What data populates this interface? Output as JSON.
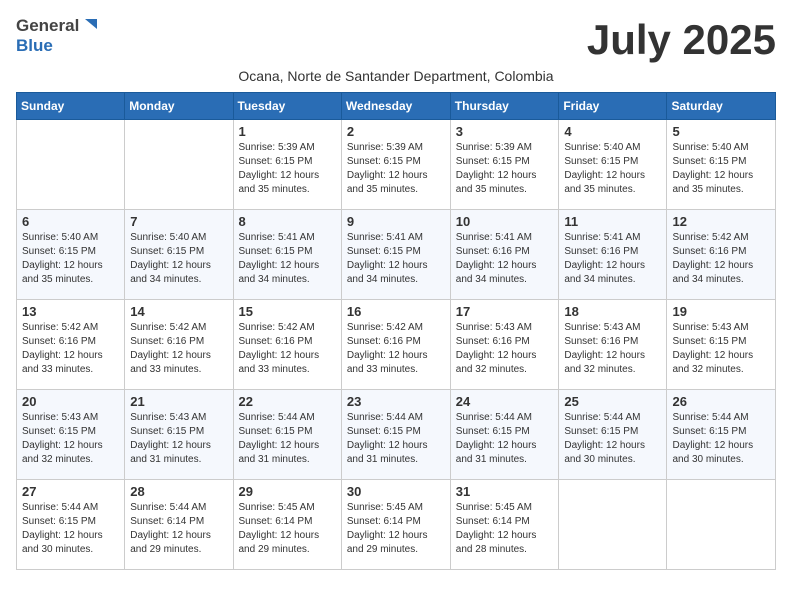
{
  "logo": {
    "general": "General",
    "blue": "Blue"
  },
  "title": "July 2025",
  "subtitle": "Ocana, Norte de Santander Department, Colombia",
  "weekdays": [
    "Sunday",
    "Monday",
    "Tuesday",
    "Wednesday",
    "Thursday",
    "Friday",
    "Saturday"
  ],
  "weeks": [
    [
      {
        "day": "",
        "info": ""
      },
      {
        "day": "",
        "info": ""
      },
      {
        "day": "1",
        "info": "Sunrise: 5:39 AM\nSunset: 6:15 PM\nDaylight: 12 hours and 35 minutes."
      },
      {
        "day": "2",
        "info": "Sunrise: 5:39 AM\nSunset: 6:15 PM\nDaylight: 12 hours and 35 minutes."
      },
      {
        "day": "3",
        "info": "Sunrise: 5:39 AM\nSunset: 6:15 PM\nDaylight: 12 hours and 35 minutes."
      },
      {
        "day": "4",
        "info": "Sunrise: 5:40 AM\nSunset: 6:15 PM\nDaylight: 12 hours and 35 minutes."
      },
      {
        "day": "5",
        "info": "Sunrise: 5:40 AM\nSunset: 6:15 PM\nDaylight: 12 hours and 35 minutes."
      }
    ],
    [
      {
        "day": "6",
        "info": "Sunrise: 5:40 AM\nSunset: 6:15 PM\nDaylight: 12 hours and 35 minutes."
      },
      {
        "day": "7",
        "info": "Sunrise: 5:40 AM\nSunset: 6:15 PM\nDaylight: 12 hours and 34 minutes."
      },
      {
        "day": "8",
        "info": "Sunrise: 5:41 AM\nSunset: 6:15 PM\nDaylight: 12 hours and 34 minutes."
      },
      {
        "day": "9",
        "info": "Sunrise: 5:41 AM\nSunset: 6:15 PM\nDaylight: 12 hours and 34 minutes."
      },
      {
        "day": "10",
        "info": "Sunrise: 5:41 AM\nSunset: 6:16 PM\nDaylight: 12 hours and 34 minutes."
      },
      {
        "day": "11",
        "info": "Sunrise: 5:41 AM\nSunset: 6:16 PM\nDaylight: 12 hours and 34 minutes."
      },
      {
        "day": "12",
        "info": "Sunrise: 5:42 AM\nSunset: 6:16 PM\nDaylight: 12 hours and 34 minutes."
      }
    ],
    [
      {
        "day": "13",
        "info": "Sunrise: 5:42 AM\nSunset: 6:16 PM\nDaylight: 12 hours and 33 minutes."
      },
      {
        "day": "14",
        "info": "Sunrise: 5:42 AM\nSunset: 6:16 PM\nDaylight: 12 hours and 33 minutes."
      },
      {
        "day": "15",
        "info": "Sunrise: 5:42 AM\nSunset: 6:16 PM\nDaylight: 12 hours and 33 minutes."
      },
      {
        "day": "16",
        "info": "Sunrise: 5:42 AM\nSunset: 6:16 PM\nDaylight: 12 hours and 33 minutes."
      },
      {
        "day": "17",
        "info": "Sunrise: 5:43 AM\nSunset: 6:16 PM\nDaylight: 12 hours and 32 minutes."
      },
      {
        "day": "18",
        "info": "Sunrise: 5:43 AM\nSunset: 6:16 PM\nDaylight: 12 hours and 32 minutes."
      },
      {
        "day": "19",
        "info": "Sunrise: 5:43 AM\nSunset: 6:15 PM\nDaylight: 12 hours and 32 minutes."
      }
    ],
    [
      {
        "day": "20",
        "info": "Sunrise: 5:43 AM\nSunset: 6:15 PM\nDaylight: 12 hours and 32 minutes."
      },
      {
        "day": "21",
        "info": "Sunrise: 5:43 AM\nSunset: 6:15 PM\nDaylight: 12 hours and 31 minutes."
      },
      {
        "day": "22",
        "info": "Sunrise: 5:44 AM\nSunset: 6:15 PM\nDaylight: 12 hours and 31 minutes."
      },
      {
        "day": "23",
        "info": "Sunrise: 5:44 AM\nSunset: 6:15 PM\nDaylight: 12 hours and 31 minutes."
      },
      {
        "day": "24",
        "info": "Sunrise: 5:44 AM\nSunset: 6:15 PM\nDaylight: 12 hours and 31 minutes."
      },
      {
        "day": "25",
        "info": "Sunrise: 5:44 AM\nSunset: 6:15 PM\nDaylight: 12 hours and 30 minutes."
      },
      {
        "day": "26",
        "info": "Sunrise: 5:44 AM\nSunset: 6:15 PM\nDaylight: 12 hours and 30 minutes."
      }
    ],
    [
      {
        "day": "27",
        "info": "Sunrise: 5:44 AM\nSunset: 6:15 PM\nDaylight: 12 hours and 30 minutes."
      },
      {
        "day": "28",
        "info": "Sunrise: 5:44 AM\nSunset: 6:14 PM\nDaylight: 12 hours and 29 minutes."
      },
      {
        "day": "29",
        "info": "Sunrise: 5:45 AM\nSunset: 6:14 PM\nDaylight: 12 hours and 29 minutes."
      },
      {
        "day": "30",
        "info": "Sunrise: 5:45 AM\nSunset: 6:14 PM\nDaylight: 12 hours and 29 minutes."
      },
      {
        "day": "31",
        "info": "Sunrise: 5:45 AM\nSunset: 6:14 PM\nDaylight: 12 hours and 28 minutes."
      },
      {
        "day": "",
        "info": ""
      },
      {
        "day": "",
        "info": ""
      }
    ]
  ]
}
